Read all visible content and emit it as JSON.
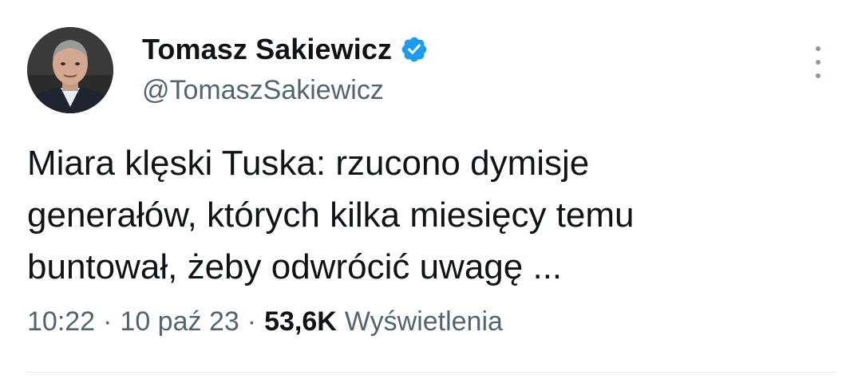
{
  "author": {
    "display_name": "Tomasz Sakiewicz",
    "handle": "@TomaszSakiewicz",
    "verified": true,
    "verified_color": "#1d9bf0"
  },
  "tweet": {
    "text_lines": [
      "Miara klęski Tuska: rzucono dymisje",
      "generałów, których kilka miesięcy temu",
      "buntował, żeby odwrócić uwagę ..."
    ]
  },
  "meta": {
    "time": "10:22",
    "separator": "·",
    "date": "10 paź 23",
    "views_count": "53,6K",
    "views_label": "Wyświetlenia"
  },
  "colors": {
    "text_primary": "#0f1419",
    "text_secondary": "#536471"
  },
  "icons": {
    "verified": "verified-badge-icon",
    "more": "more-vertical-icon"
  }
}
